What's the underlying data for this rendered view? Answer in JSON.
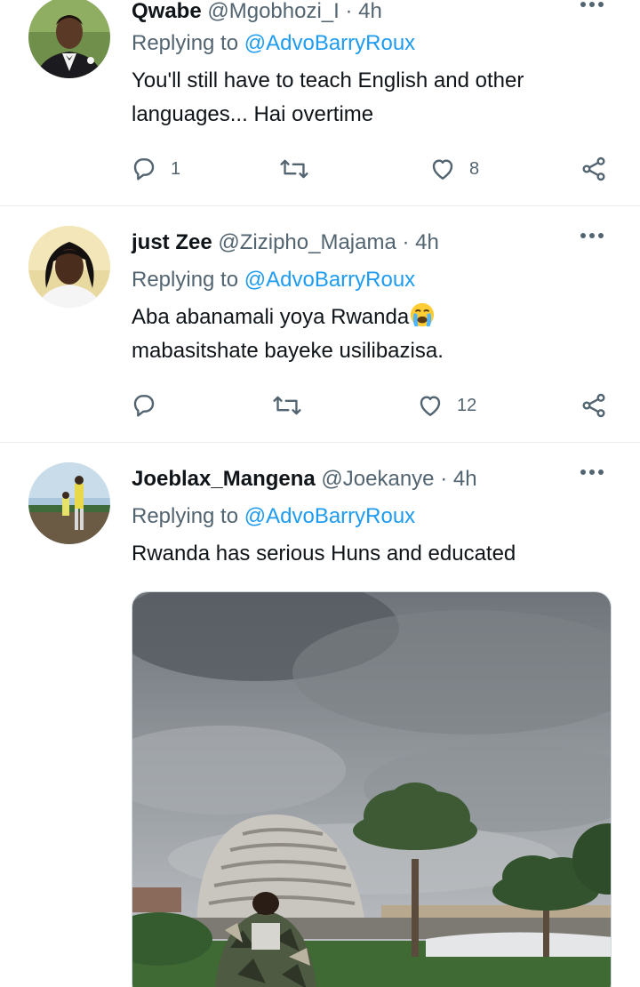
{
  "tweets": [
    {
      "name": "Qwabe",
      "handle": "@Mgobhozi_I",
      "dot": "·",
      "time": "4h",
      "replying_label": "Replying to",
      "replying_to": "@AdvoBarryRoux",
      "text_lines": [
        "You'll still have to teach English and other",
        "languages... Hai overtime"
      ],
      "reply_count": "1",
      "retweet_count": "",
      "like_count": "8",
      "avatar_icon": "profile-photo-man-suit"
    },
    {
      "name": "just Zee",
      "handle": "@Zizipho_Majama",
      "dot": "·",
      "time": "4h",
      "replying_label": "Replying to",
      "replying_to": "@AdvoBarryRoux",
      "text_lines": [
        "Aba abanamali yoya Rwanda",
        "mabasitshate bayeke usilibazisa."
      ],
      "emoji": "crying-face-emoji",
      "reply_count": "",
      "retweet_count": "",
      "like_count": "12",
      "avatar_icon": "profile-photo-woman"
    },
    {
      "name": "Joeblax_Mangena",
      "handle": "@Joekanye",
      "dot": "·",
      "time": "4h",
      "replying_label": "Replying to",
      "replying_to": "@AdvoBarryRoux",
      "text_lines": [
        "Rwanda has serious Huns and educated"
      ],
      "media": "photo-kigali-convention-centre-palm-trees-cloudy-sky",
      "avatar_icon": "profile-photo-outdoors"
    }
  ],
  "colors": {
    "text": "#0f1419",
    "secondary": "#536471",
    "link": "#1d9bf0",
    "divider": "#e6ecf0"
  }
}
